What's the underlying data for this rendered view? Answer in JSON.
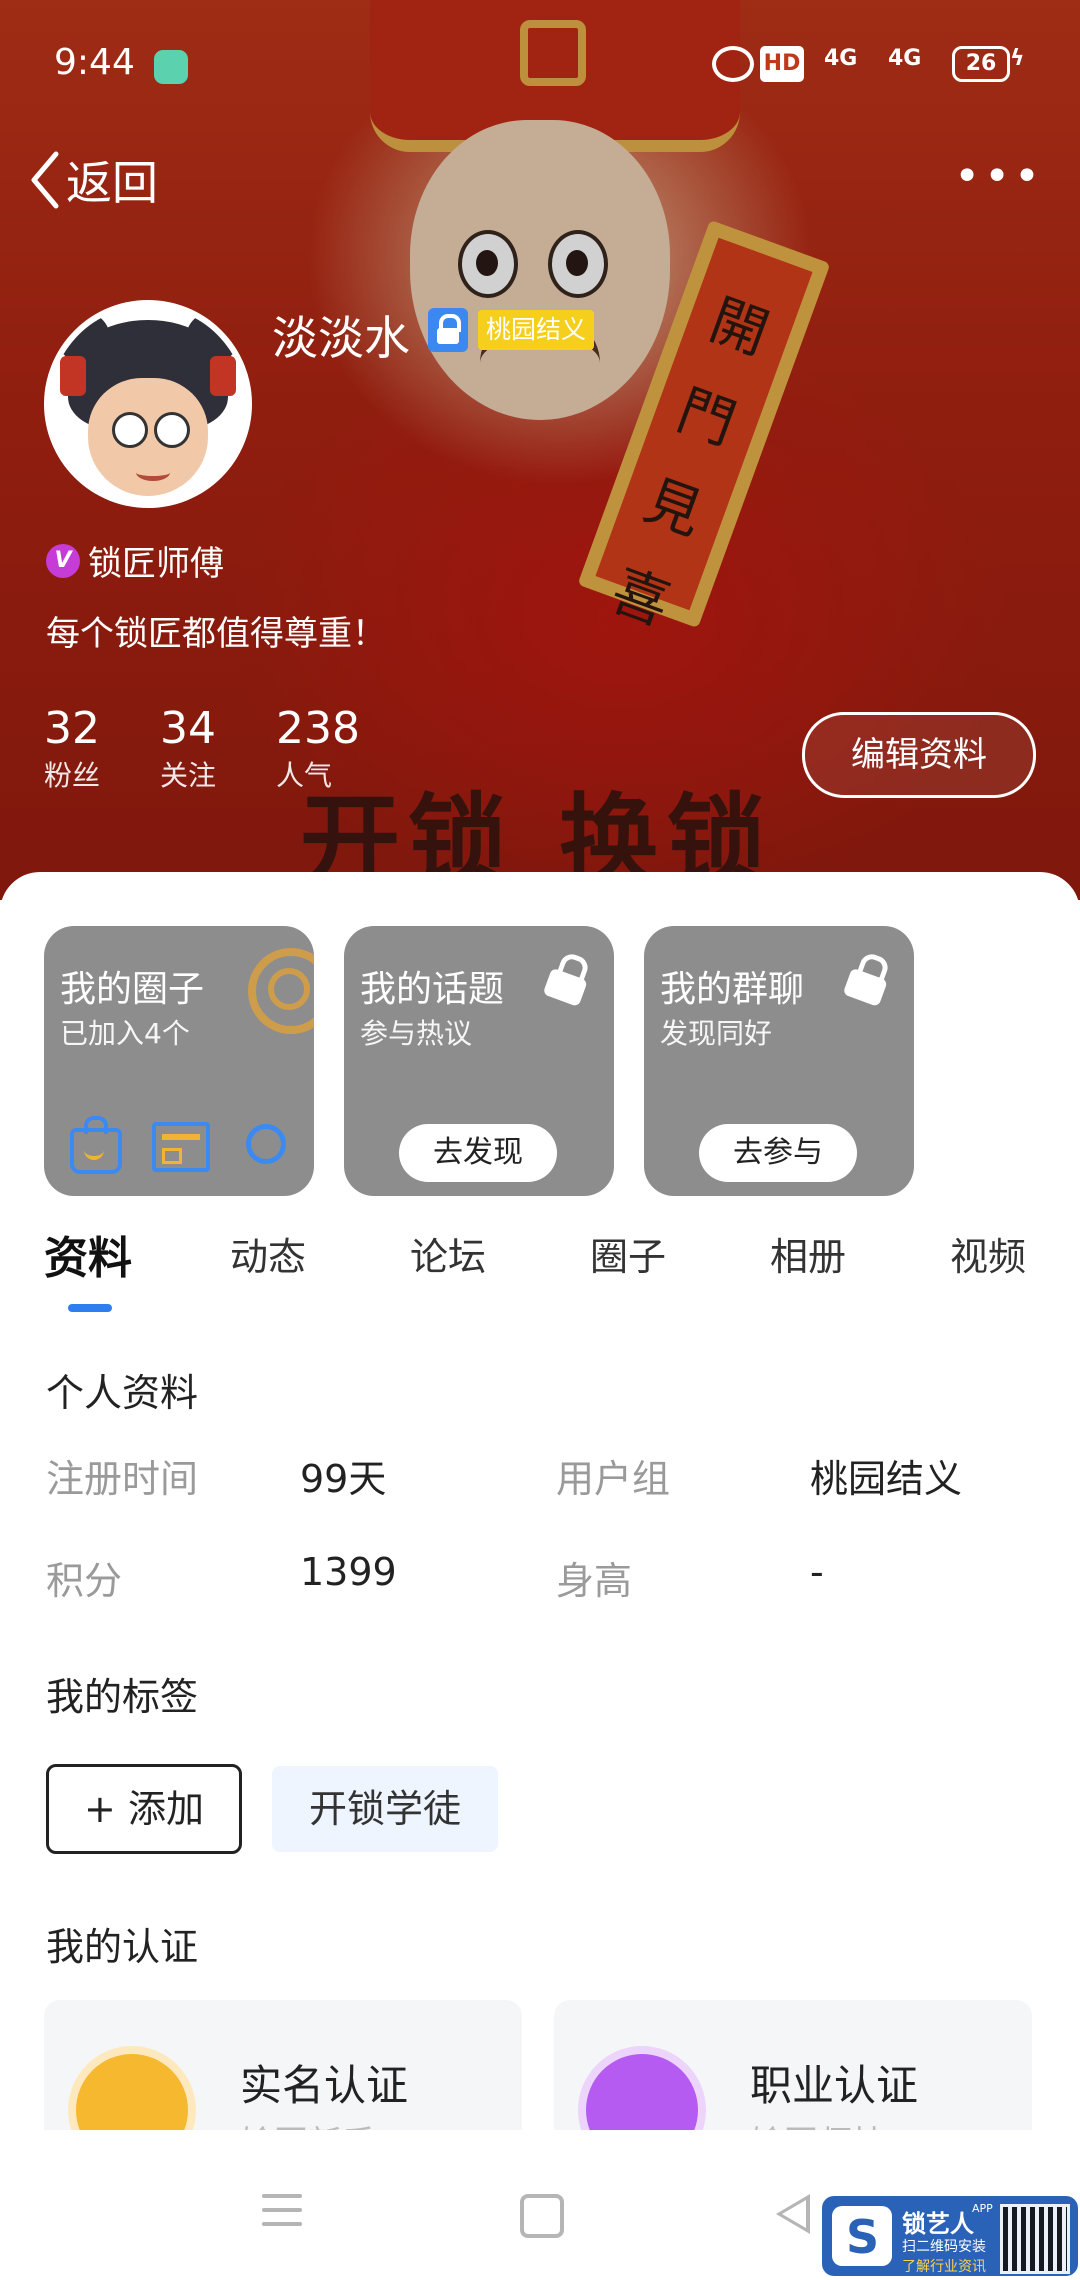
{
  "status_bar": {
    "time": "9:44",
    "hd": "HD",
    "signal1": "4G",
    "signal2": "4G",
    "battery": "26"
  },
  "nav": {
    "back_label": "返回",
    "more_label": "•••"
  },
  "hero": {
    "banner_text": "开锁 换锁",
    "scroll_text": "開門見喜"
  },
  "profile": {
    "username": "淡淡水",
    "group_badge": "桃园结义",
    "cert_title": "锁匠师傅",
    "signature": "每个锁匠都值得尊重！",
    "edit_button": "编辑资料",
    "stats": [
      {
        "value": "32",
        "label": "粉丝"
      },
      {
        "value": "34",
        "label": "关注"
      },
      {
        "value": "238",
        "label": "人气"
      }
    ]
  },
  "cards": [
    {
      "title": "我的圈子",
      "subtitle": "已加入4个"
    },
    {
      "title": "我的话题",
      "subtitle": "参与热议",
      "button": "去发现"
    },
    {
      "title": "我的群聊",
      "subtitle": "发现同好",
      "button": "去参与"
    }
  ],
  "tabs": [
    "资料",
    "动态",
    "论坛",
    "圈子",
    "相册",
    "视频"
  ],
  "active_tab": "资料",
  "personal": {
    "section_title": "个人资料",
    "rows": [
      {
        "label1": "注册时间",
        "value1": "99天",
        "label2": "用户组",
        "value2": "桃园结义"
      },
      {
        "label1": "积分",
        "value1": "1399",
        "label2": "身高",
        "value2": "-"
      }
    ]
  },
  "tags": {
    "section_title": "我的标签",
    "add_label": "+ 添加",
    "items": [
      "开锁学徒"
    ]
  },
  "certification": {
    "section_title": "我的认证",
    "items": [
      {
        "name": "实名认证",
        "sub": "输回新手",
        "color": "#f5b82e"
      },
      {
        "name": "职业认证",
        "sub": "输回师技",
        "color": "#b65bf2"
      }
    ]
  },
  "promo": {
    "name": "锁艺人",
    "app": "APP",
    "line1": "扫二维码安装",
    "line2": "了解行业资讯"
  },
  "colors": {
    "accent": "#2f7ef0",
    "card_gray": "#8d8d8d",
    "badge_yellow": "#f6cf1c",
    "v_purple": "#c63cd6"
  }
}
